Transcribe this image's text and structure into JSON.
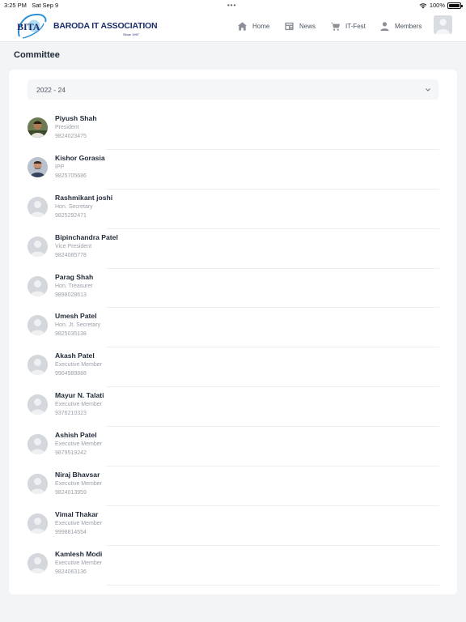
{
  "status_bar": {
    "time": "3:25 PM",
    "date": "Sat Sep 9",
    "battery": "100%"
  },
  "brand": {
    "logo_text": "BITA",
    "name": "BARODA IT ASSOCIATION",
    "since": "Since 1997"
  },
  "nav": {
    "items": [
      {
        "label": "Home",
        "icon": "home-icon"
      },
      {
        "label": "News",
        "icon": "news-icon"
      },
      {
        "label": "IT-Fest",
        "icon": "cart-icon"
      },
      {
        "label": "Members",
        "icon": "person-icon"
      }
    ]
  },
  "page": {
    "title": "Committee"
  },
  "year_select": {
    "value": "2022 - 24"
  },
  "members": [
    {
      "name": "Piyush Shah",
      "role": "President",
      "phone": "9824023475",
      "photo": "photo"
    },
    {
      "name": "Kishor Gorasia",
      "role": "IPP",
      "phone": "9825705686",
      "photo": "photo"
    },
    {
      "name": "Rashmikant joshi",
      "role": "Hon. Secretary",
      "phone": "9825292471",
      "photo": "placeholder"
    },
    {
      "name": "Bipinchandra Patel",
      "role": "Vice President",
      "phone": "9824085778",
      "photo": "placeholder"
    },
    {
      "name": "Parag Shah",
      "role": "Hon. Treasurer",
      "phone": "9898028613",
      "photo": "placeholder"
    },
    {
      "name": "Umesh Patel",
      "role": "Hon. Jt. Secretary",
      "phone": "9825035138",
      "photo": "placeholder"
    },
    {
      "name": "Akash Patel",
      "role": "Executive Member",
      "phone": "9904989888",
      "photo": "placeholder"
    },
    {
      "name": "Mayur N. Talati",
      "role": "Executive Member",
      "phone": "9376210323",
      "photo": "placeholder"
    },
    {
      "name": "Ashish Patel",
      "role": "Executive Member",
      "phone": "9879519242",
      "photo": "placeholder"
    },
    {
      "name": "Niraj Bhavsar",
      "role": "Executive Member",
      "phone": "9824013959",
      "photo": "placeholder"
    },
    {
      "name": "Vimal Thakar",
      "role": "Executive Member",
      "phone": "9998814554",
      "photo": "placeholder"
    },
    {
      "name": "Kamlesh Modi",
      "role": "Executive Member",
      "phone": "9824063136",
      "photo": "placeholder"
    }
  ]
}
